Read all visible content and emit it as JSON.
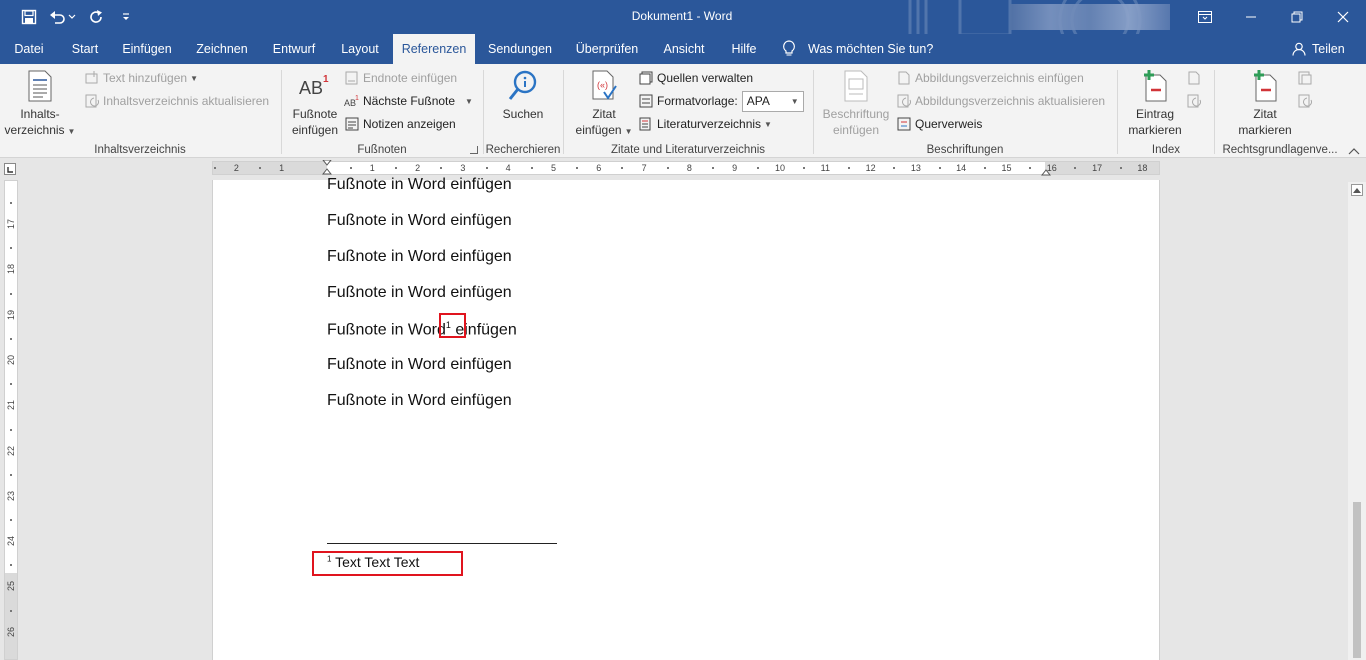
{
  "title": {
    "doc": "Dokument1",
    "sep": " - ",
    "app": "Word"
  },
  "tabs": [
    "Datei",
    "Start",
    "Einfügen",
    "Zeichnen",
    "Entwurf",
    "Layout",
    "Referenzen",
    "Sendungen",
    "Überprüfen",
    "Ansicht",
    "Hilfe"
  ],
  "tellme": "Was möchten Sie tun?",
  "share": "Teilen",
  "ribbon": {
    "toc": {
      "btn1": "Inhalts-",
      "btn2": "verzeichnis",
      "add_text": "Text hinzufügen",
      "update": "Inhaltsverzeichnis aktualisieren",
      "label": "Inhaltsverzeichnis"
    },
    "footnotes": {
      "insert1": "Fußnote",
      "insert2": "einfügen",
      "endnote": "Endnote einfügen",
      "next": "Nächste Fußnote",
      "show": "Notizen anzeigen",
      "label": "Fußnoten"
    },
    "research": {
      "search": "Suchen",
      "label": "Recherchieren"
    },
    "citations": {
      "cite1": "Zitat",
      "cite2": "einfügen",
      "manage": "Quellen verwalten",
      "style_label": "Formatvorlage:",
      "style_value": "APA",
      "bib": "Literaturverzeichnis",
      "label": "Zitate und Literaturverzeichnis"
    },
    "captions": {
      "caption1": "Beschriftung",
      "caption2": "einfügen",
      "figures": "Abbildungsverzeichnis einfügen",
      "update": "Abbildungsverzeichnis aktualisieren",
      "crossref": "Querverweis",
      "label": "Beschriftungen"
    },
    "index": {
      "mark1": "Eintrag",
      "mark2": "markieren",
      "label": "Index"
    },
    "authorities": {
      "mark1": "Zitat",
      "mark2": "markieren",
      "label": "Rechtsgrundlagenve..."
    }
  },
  "document": {
    "lines": [
      "Fußnote in Word einfügen",
      "Fußnote in Word einfügen",
      "Fußnote in Word einfügen",
      "Fußnote in Word einfügen"
    ],
    "ref_line_before": "Fußnote in Word",
    "ref_mark": "1",
    "ref_line_after": " einfügen",
    "lines_after": [
      "Fußnote in Word einfügen",
      "Fußnote in Word einfügen"
    ],
    "footnote_mark": "1",
    "footnote_text": "Text Text Text"
  },
  "ruler_h": [
    "2",
    "1",
    "1",
    "2",
    "3",
    "4",
    "5",
    "6",
    "7",
    "8",
    "9",
    "10",
    "11",
    "12",
    "13",
    "14",
    "15",
    "16",
    "17",
    "18"
  ],
  "ruler_v": [
    "17",
    "18",
    "19",
    "20",
    "21",
    "22",
    "23",
    "24",
    "25",
    "26"
  ],
  "colors": {
    "title_bg": "#2b579a",
    "highlight": "#e0141e"
  }
}
